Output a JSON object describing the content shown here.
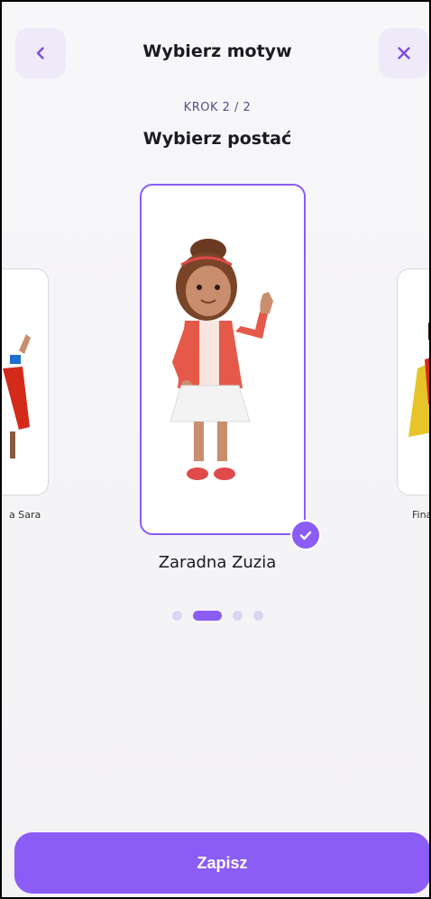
{
  "header": {
    "title": "Wybierz motyw",
    "back_icon": "chevron-left-icon",
    "close_icon": "close-icon"
  },
  "step": {
    "label": "KROK 2 / 2",
    "subtitle": "Wybierz postać"
  },
  "carousel": {
    "left_card_label": "a Sara",
    "right_card_label": "Fina",
    "selected_name": "Zaradna Zuzia",
    "selected_icon": "check-circle-icon",
    "page_count": 4,
    "active_page": 2
  },
  "footer": {
    "save_label": "Zapisz"
  },
  "colors": {
    "accent": "#8b5cf6",
    "accent_light": "#efeaf9",
    "dot_inactive": "#dcd5f2"
  }
}
